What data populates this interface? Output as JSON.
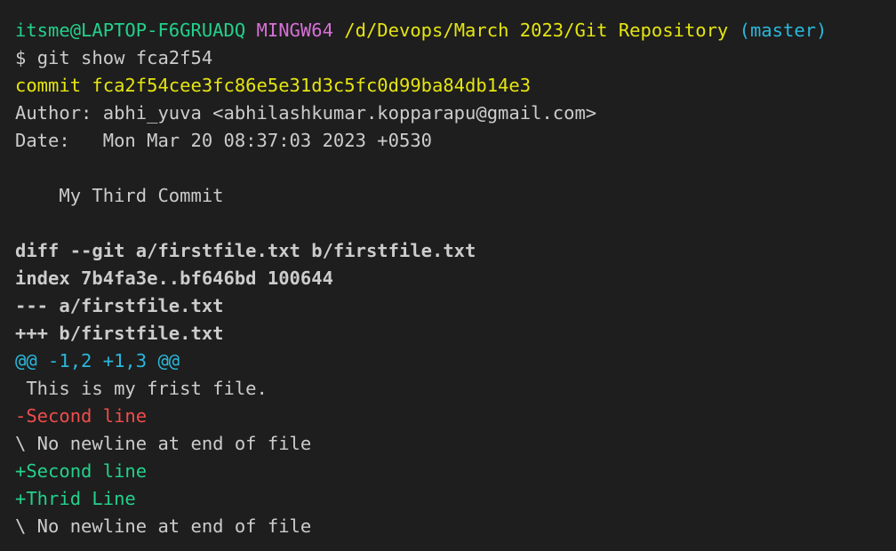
{
  "window": {
    "title": ""
  },
  "colors": {
    "background": "#1e1e1e",
    "text": "#cccccc",
    "user_host": "#23d18b",
    "shell": "#d670d6",
    "path": "#e5e510",
    "branch": "#29b8db",
    "removed": "#f14c4c",
    "added": "#23d18b"
  },
  "prompt": {
    "user_host": "itsme@LAPTOP-F6GRUADQ",
    "shell": "MINGW64",
    "path": "/d/Devops/March 2023/Git Repository",
    "branch": "(master)"
  },
  "command": {
    "symbol": "$",
    "text": "git show fca2f54"
  },
  "commit": {
    "header": "commit fca2f54cee3fc86e5e31d3c5fc0d99ba84db14e3",
    "author": "Author: abhi_yuva <abhilashkumar.kopparapu@gmail.com>",
    "date": "Date:   Mon Mar 20 08:37:03 2023 +0530",
    "message": "    My Third Commit"
  },
  "diff": {
    "header": "diff --git a/firstfile.txt b/firstfile.txt",
    "index": "index 7b4fa3e..bf646bd 100644",
    "old_file": "--- a/firstfile.txt",
    "new_file": "+++ b/firstfile.txt",
    "hunk": "@@ -1,2 +1,3 @@",
    "lines": [
      {
        "kind": "context",
        "text": " This is my frist file."
      },
      {
        "kind": "removed",
        "text": "-Second line"
      },
      {
        "kind": "context",
        "text": "\\ No newline at end of file"
      },
      {
        "kind": "added",
        "text": "+Second line"
      },
      {
        "kind": "added",
        "text": "+Thrid Line"
      },
      {
        "kind": "context",
        "text": "\\ No newline at end of file"
      }
    ]
  }
}
